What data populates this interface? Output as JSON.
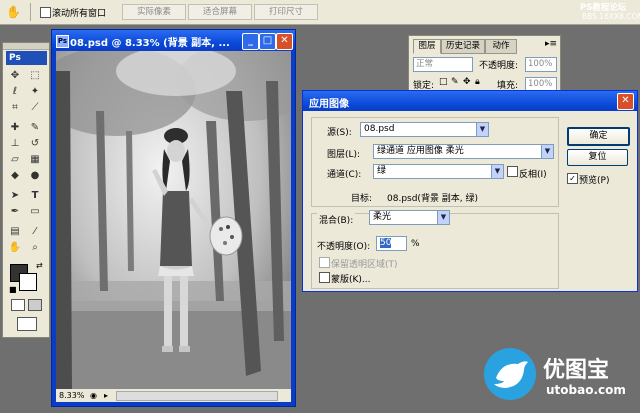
{
  "optbar": {
    "scroll_all_label": "滚动所有窗口",
    "actual_pixels": "实际像素",
    "fit_screen": "适合屏幕",
    "print_size": "打印尺寸"
  },
  "watermark": {
    "line1": "PS教程论坛",
    "line2": "BBS.16XX8.COM"
  },
  "tools": {
    "app_label": "Ps"
  },
  "document": {
    "title": "08.psd @ 8.33% (背景 副本, ...",
    "zoom": "8.33%"
  },
  "layers_panel": {
    "tabs": [
      "图层",
      "历史记录",
      "动作"
    ],
    "blend_mode": "正常",
    "opacity_label": "不透明度:",
    "opacity_value": "100%",
    "lock_label": "锁定:",
    "fill_label": "填充:",
    "fill_value": "100%"
  },
  "dialog": {
    "title": "应用图像",
    "source_label": "源(S):",
    "source_value": "08.psd",
    "layer_label": "图层(L):",
    "layer_value": "绿通道 应用图像 柔光",
    "channel_label": "通道(C):",
    "channel_value": "绿",
    "invert_label": "反相(I)",
    "target_label": "目标:",
    "target_value": "08.psd(背景 副本, 绿)",
    "blending_label": "混合(B):",
    "blending_value": "柔光",
    "opacity_label": "不透明度(O):",
    "opacity_value": "50",
    "opacity_unit": "%",
    "preserve_label": "保留透明区域(T)",
    "mask_label": "蒙版(K)...",
    "ok": "确定",
    "reset": "复位",
    "preview_label": "预览(P)"
  },
  "brand": {
    "name": "优图宝",
    "url": "utobao.com"
  },
  "colors": {
    "xp_title_blue": "#0a3cc7",
    "dialog_face": "#ece9d8",
    "brand_blue": "#2aa2e0"
  }
}
